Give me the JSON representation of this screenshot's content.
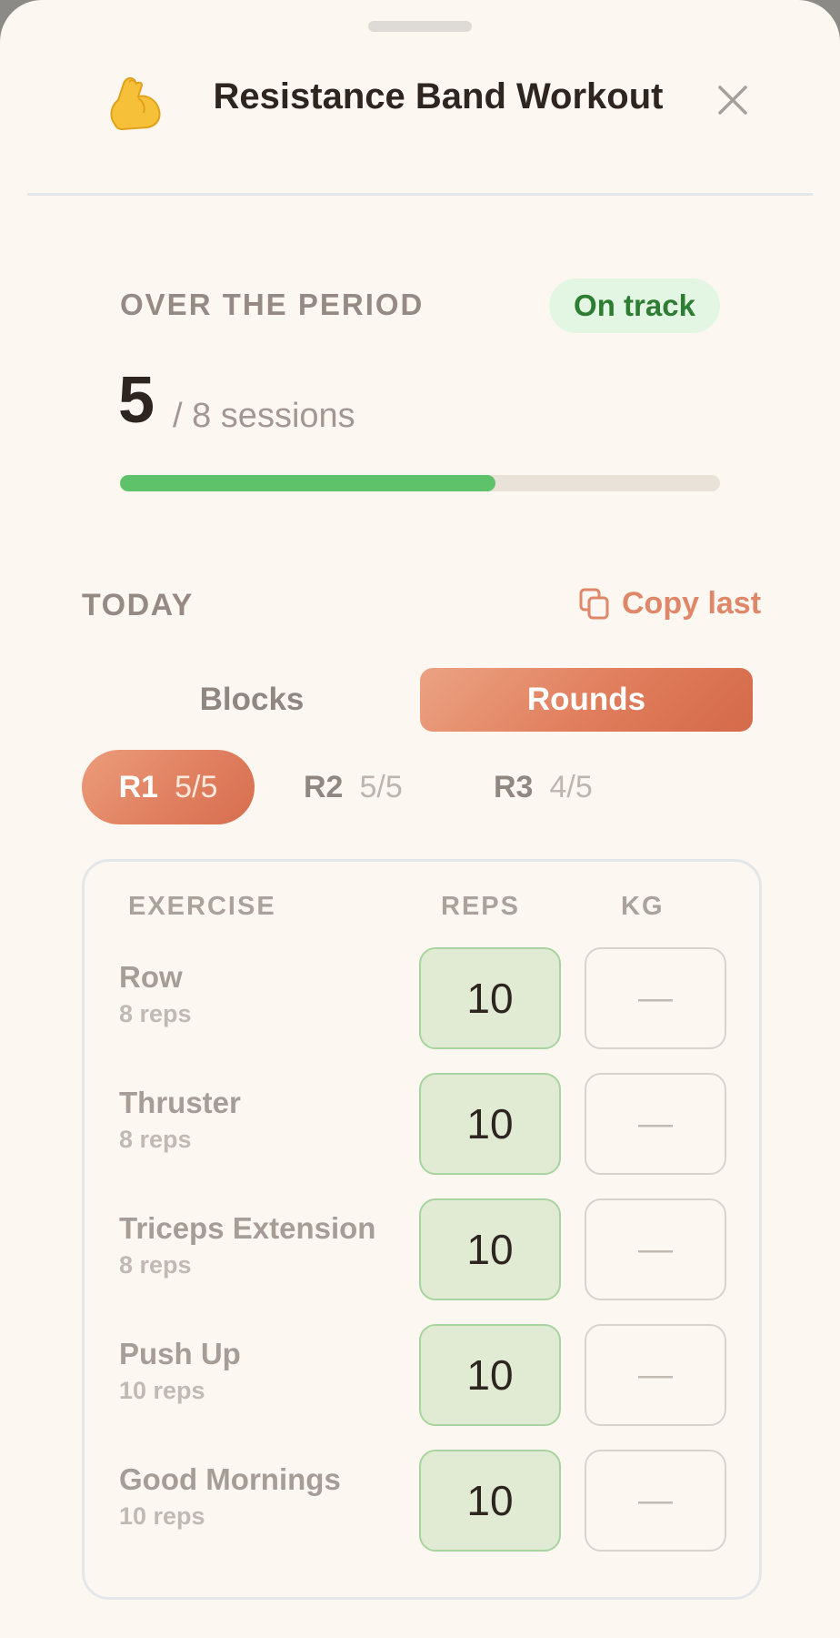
{
  "header": {
    "emoji": "💪",
    "title": "Resistance Band Workout"
  },
  "period": {
    "label": "OVER THE PERIOD",
    "status": "On track",
    "completed": "5",
    "total_text": "/ 8 sessions",
    "progress_fraction": 0.625
  },
  "today": {
    "label": "TODAY",
    "copy_last": "Copy last"
  },
  "view_toggle": {
    "blocks": "Blocks",
    "rounds": "Rounds",
    "selected": "Rounds"
  },
  "rounds": [
    {
      "label": "R1",
      "count": "5/5",
      "active": true
    },
    {
      "label": "R2",
      "count": "5/5",
      "active": false
    },
    {
      "label": "R3",
      "count": "4/5",
      "active": false
    }
  ],
  "table": {
    "headers": {
      "exercise": "EXERCISE",
      "reps": "REPS",
      "kg": "KG"
    },
    "rows": [
      {
        "name": "Row",
        "target": "8 reps",
        "reps": "10",
        "kg": "—"
      },
      {
        "name": "Thruster",
        "target": "8 reps",
        "reps": "10",
        "kg": "—"
      },
      {
        "name": "Triceps Extension",
        "target": "8 reps",
        "reps": "10",
        "kg": "—"
      },
      {
        "name": "Push Up",
        "target": "10 reps",
        "reps": "10",
        "kg": "—"
      },
      {
        "name": "Good Mornings",
        "target": "10 reps",
        "reps": "10",
        "kg": "—"
      }
    ]
  },
  "colors": {
    "background": "#fcf7f0",
    "accent": "#e07d5c",
    "success": "#5ec26a",
    "success_text": "#2e7d32",
    "reps_fill": "#e1ebd3"
  },
  "icons": {
    "header": "flexed-biceps-icon",
    "close": "close-icon",
    "copy": "copy-icon"
  }
}
